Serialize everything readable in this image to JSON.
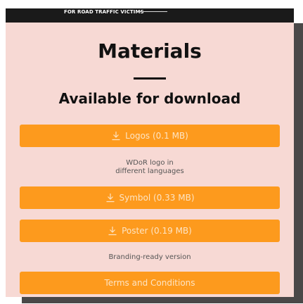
{
  "header": {
    "tagline": "FOR ROAD TRAFFIC VICTIMS"
  },
  "main": {
    "title": "Materials",
    "subtitle": "Available for download",
    "downloads": [
      {
        "label": "Logos (0.1 MB)",
        "icon": "download-icon",
        "note_line1": "WDoR logo in",
        "note_line2": "different languages"
      },
      {
        "label": "Symbol (0.33 MB)",
        "icon": "download-icon"
      },
      {
        "label": "Poster (0.19 MB)",
        "icon": "download-icon",
        "note_line1": "Branding-ready version"
      }
    ],
    "terms_label": "Terms and Conditions"
  },
  "colors": {
    "background": "#f7d9d4",
    "button": "#fd9a1d",
    "button_text": "#fde4c4",
    "header_bar": "#1a1a1a",
    "heading": "#111111"
  }
}
